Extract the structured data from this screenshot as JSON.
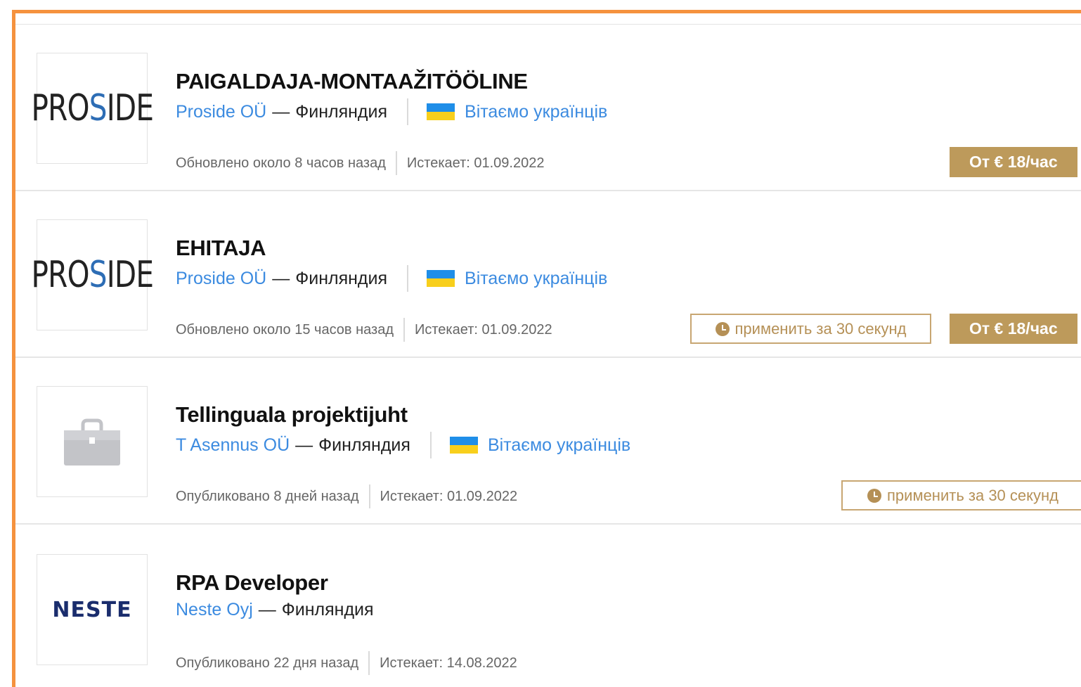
{
  "jobs": [
    {
      "title": "PAIGALDAJA-MONTAAŽITÖÖLINE",
      "company": "Proside OÜ",
      "dash": "—",
      "country": "Финляндия",
      "ukraine_label": "Вітаємо українців",
      "updated": "Обновлено около 8 часов назад",
      "expires": "Истекает: 01.09.2022",
      "salary": "От € 18/час",
      "logo_text": {
        "a": "PRO",
        "s": "S",
        "b": "IDE"
      }
    },
    {
      "title": "EHITAJA",
      "company": "Proside OÜ",
      "dash": "—",
      "country": "Финляндия",
      "ukraine_label": "Вітаємо українців",
      "updated": "Обновлено около 15 часов назад",
      "expires": "Истекает: 01.09.2022",
      "apply": "применить за 30 секунд",
      "salary": "От € 18/час",
      "logo_text": {
        "a": "PRO",
        "s": "S",
        "b": "IDE"
      }
    },
    {
      "title": "Tellinguala projektijuht",
      "company": "T Asennus OÜ",
      "dash": "—",
      "country": "Финляндия",
      "ukraine_label": "Вітаємо українців",
      "updated": "Опубликовано 8 дней назад",
      "expires": "Истекает: 01.09.2022",
      "apply": "применить за 30 секунд",
      "logo_icon": "briefcase-icon"
    },
    {
      "title": "RPA Developer",
      "company": "Neste Oyj",
      "dash": "—",
      "country": "Финляндия",
      "updated": "Опубликовано 22 дня назад",
      "expires": "Истекает: 14.08.2022",
      "logo_text": "NESTE"
    }
  ],
  "colors": {
    "accent_border": "#f5923e",
    "link": "#3c8be0",
    "salary_bg": "#bd9a5b",
    "apply_border": "#c8a672"
  }
}
